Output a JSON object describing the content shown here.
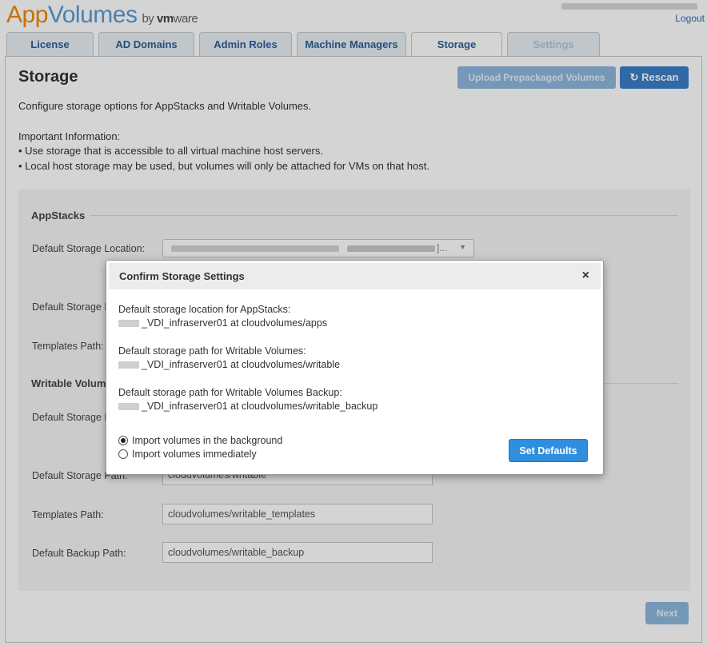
{
  "header": {
    "logo_app": "App",
    "logo_volumes": "Volumes",
    "logo_by": "by",
    "logo_vendor": "vm",
    "logo_vendor_suffix": "ware",
    "logout_label": "Logout"
  },
  "tabs": [
    {
      "label": "License"
    },
    {
      "label": "AD Domains"
    },
    {
      "label": "Admin Roles"
    },
    {
      "label": "Machine Managers"
    },
    {
      "label": "Storage"
    },
    {
      "label": "Settings"
    }
  ],
  "page": {
    "title": "Storage",
    "upload_label": "Upload Prepackaged Volumes",
    "rescan_label": "Rescan",
    "description": "Configure storage options for AppStacks and Writable Volumes.",
    "info_heading": "Important Information:",
    "info_1": "• Use storage that is accessible to all virtual machine host servers.",
    "info_2": "• Local host storage may be used, but volumes will only be attached for VMs on that host.",
    "next_label": "Next"
  },
  "appstacks": {
    "title": "AppStacks",
    "storage_location_label": "Default Storage Location:",
    "storage_location_suffix": "]...",
    "storage_path_label": "Default Storage Path:",
    "templates_label": "Templates Path:"
  },
  "writable": {
    "title": "Writable Volumes",
    "storage_location_label": "Default Storage Location:",
    "storage_path_label": "Default Storage Path:",
    "storage_path_value": "cloudvolumes/writable",
    "templates_label": "Templates Path:",
    "templates_value": "cloudvolumes/writable_templates",
    "backup_label": "Default Backup Path:",
    "backup_value": "cloudvolumes/writable_backup"
  },
  "modal": {
    "title": "Confirm Storage Settings",
    "close_glyph": "×",
    "appstacks_label": "Default storage location for AppStacks:",
    "appstacks_value": "_VDI_infraserver01 at cloudvolumes/apps",
    "writable_label": "Default storage path for Writable Volumes:",
    "writable_value": "_VDI_infraserver01 at cloudvolumes/writable",
    "backup_label": "Default storage path for Writable Volumes Backup:",
    "backup_value": "_VDI_infraserver01 at cloudvolumes/writable_backup",
    "radio_background": "Import volumes in the background",
    "radio_immediate": "Import volumes immediately",
    "set_defaults_label": "Set Defaults"
  },
  "icons": {
    "rescan": "refresh-icon",
    "close": "close-icon",
    "dropdown": "chevron-down-icon"
  },
  "colors": {
    "brand_orange": "#f18a00",
    "brand_blue": "#5a9bd5",
    "primary_button": "#2f8ede",
    "tab_text": "#2d5f93"
  }
}
